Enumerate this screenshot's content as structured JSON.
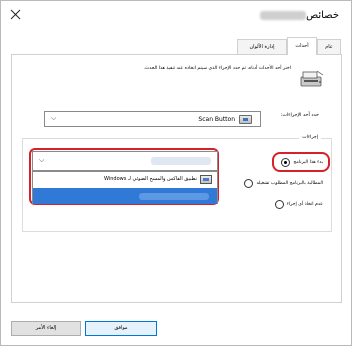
{
  "window": {
    "title": "خصائص",
    "close_label": "×"
  },
  "tabs": [
    {
      "label": "عام",
      "active": false
    },
    {
      "label": "أحداث",
      "active": true
    },
    {
      "label": "إدارة الألوان",
      "active": false
    }
  ],
  "events_panel": {
    "description": "اختر أحد الأحداث أدناه، ثم حدد الإجراء الذي سيتم اتخاذه عند تنفيذ هذا الحدث.",
    "select_label": "حدد أحد الإجراءات:",
    "selected_event": "Scan Button",
    "actions_group_title": "إجراءات",
    "radios": [
      {
        "label": "بدء هذا البرنامج",
        "checked": true
      },
      {
        "label": "المطالبة بالبرنامج المطلوب تشغيله",
        "checked": false
      },
      {
        "label": "عدم اتخاذ أي إجراء",
        "checked": false
      }
    ],
    "program_dropdown": {
      "items": [
        {
          "label": "تطبيق الفاكس والمسح الضوئي لـ Windows",
          "selected": false
        }
      ]
    }
  },
  "footer": {
    "ok_label": "موافق",
    "cancel_label": "إلغاء الأمر"
  },
  "colors": {
    "highlight": "#d6202a",
    "selection": "#3079d7",
    "accent": "#0078d7"
  }
}
